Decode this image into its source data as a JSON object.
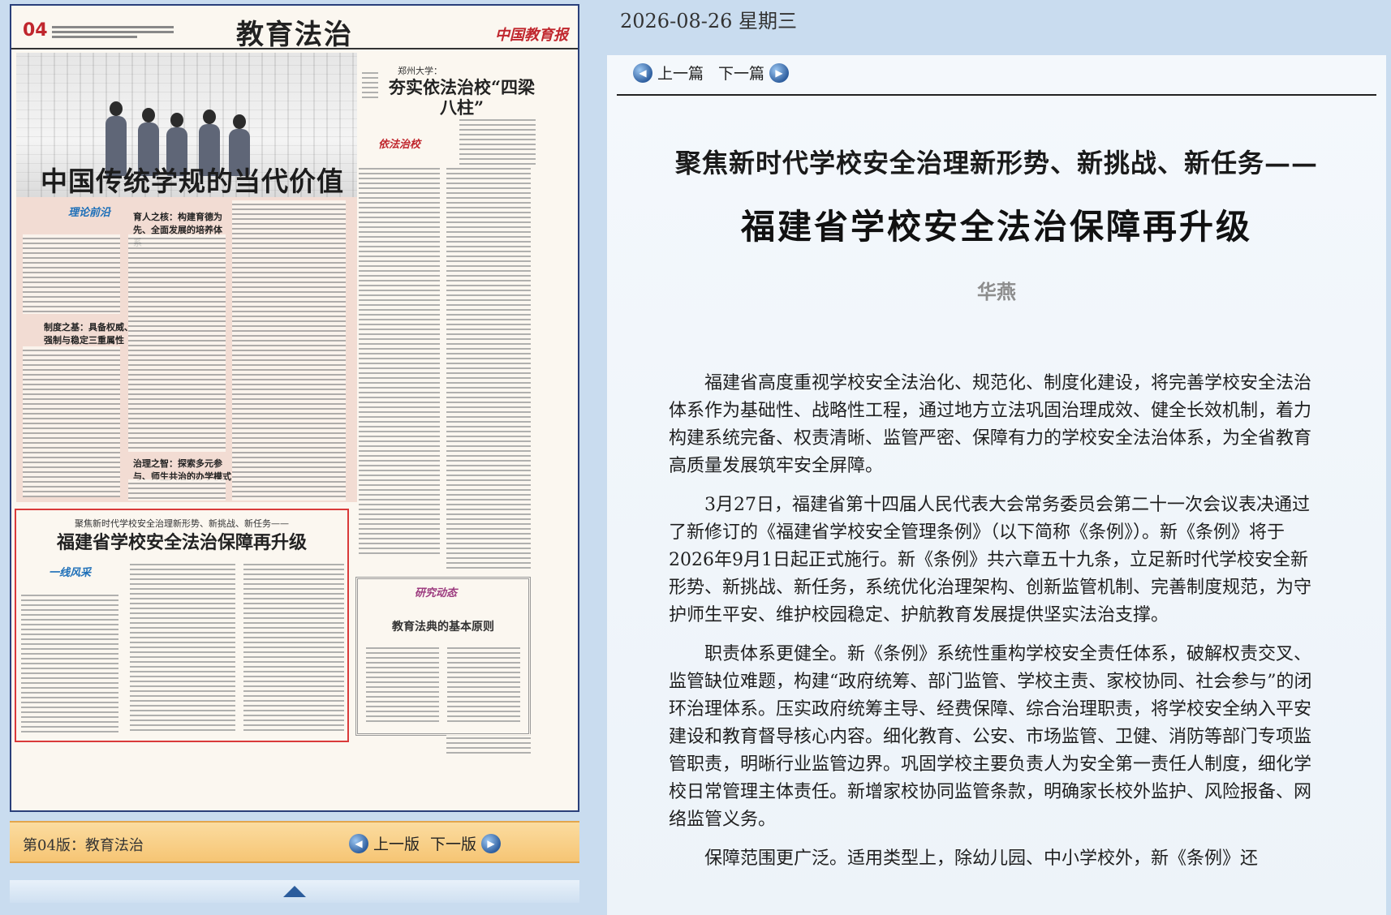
{
  "newspaper": {
    "page_number": "04",
    "section_title": "教育法治",
    "paper_name": "中国教育报",
    "main_headline": "中国传统学规的当代价值",
    "column_logo_1": "理论前沿",
    "kicker_1": "育人之核：构建育德为先、全面发展的培养体系",
    "kicker_2": "制度之基：具备权威、强制与稳定三重属性",
    "kicker_3": "治理之智：探索多元参与、师生共治的办学模式",
    "side_sub": "郑州大学：",
    "side_title": "夯实依法治校“四梁八柱”",
    "side_logo": "依法治校",
    "boxed_kicker": "聚焦新时代学校安全治理新形势、新挑战、新任务——",
    "boxed_title": "福建省学校安全法治保障再升级",
    "column_logo_2": "一线风采",
    "frame_logo": "研究动态",
    "frame_title": "教育法典的基本原则"
  },
  "page_footer": {
    "edition_label": "第04版：教育法治",
    "prev_label": "上一版",
    "next_label": "下一版"
  },
  "article": {
    "date": "2026-08-26 星期三",
    "prev_label": "上一篇",
    "next_label": "下一篇",
    "pre_title": "聚焦新时代学校安全治理新形势、新挑战、新任务——",
    "title": "福建省学校安全法治保障再升级",
    "author": "华燕",
    "paragraphs": [
      "福建省高度重视学校安全法治化、规范化、制度化建设，将完善学校安全法治体系作为基础性、战略性工程，通过地方立法巩固治理成效、健全长效机制，着力构建系统完备、权责清晰、监管严密、保障有力的学校安全法治体系，为全省教育高质量发展筑牢安全屏障。",
      "3月27日，福建省第十四届人民代表大会常务委员会第二十一次会议表决通过了新修订的《福建省学校安全管理条例》（以下简称《条例》）。新《条例》将于2026年9月1日起正式施行。新《条例》共六章五十九条，立足新时代学校安全新形势、新挑战、新任务，系统优化治理架构、创新监管机制、完善制度规范，为守护师生平安、维护校园稳定、护航教育发展提供坚实法治支撑。",
      "职责体系更健全。新《条例》系统性重构学校安全责任体系，破解权责交叉、监管缺位难题，构建“政府统筹、部门监管、学校主责、家校协同、社会参与”的闭环治理体系。压实政府统筹主导、经费保障、综合治理职责，将学校安全纳入平安建设和教育督导核心内容。细化教育、公安、市场监管、卫健、消防等部门专项监管职责，明晰行业监管边界。巩固学校主要负责人为安全第一责任人制度，细化学校日常管理主体责任。新增家校协同监管条款，明确家长校外监护、风险报备、网络监管义务。",
      "保障范围更广泛。适用类型上，除幼儿园、中小学校外，新《条例》还"
    ]
  }
}
